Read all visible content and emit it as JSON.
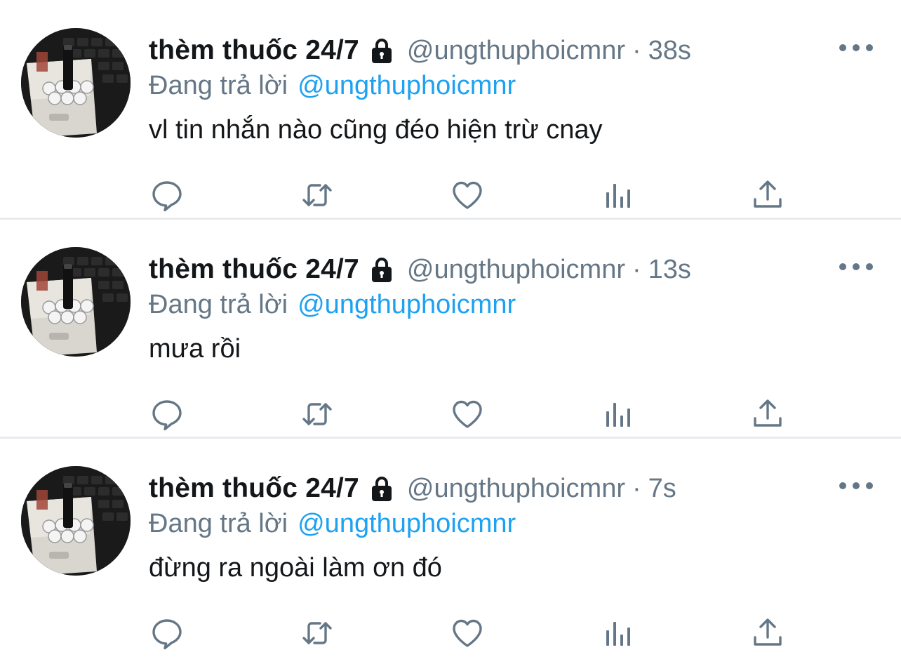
{
  "tweets": [
    {
      "name": "thèm thuốc 24/7",
      "handle": "@ungthuphoicmnr",
      "separator": "·",
      "time": "38s",
      "reply_prefix": "Đang trả lời",
      "reply_to": "@ungthuphoicmnr",
      "text": "vl tin nhắn nào cũng đéo hiện trừ cnay"
    },
    {
      "name": "thèm thuốc 24/7",
      "handle": "@ungthuphoicmnr",
      "separator": "·",
      "time": "13s",
      "reply_prefix": "Đang trả lời",
      "reply_to": "@ungthuphoicmnr",
      "text": "mưa rồi"
    },
    {
      "name": "thèm thuốc 24/7",
      "handle": "@ungthuphoicmnr",
      "separator": "·",
      "time": "7s",
      "reply_prefix": "Đang trả lời",
      "reply_to": "@ungthuphoicmnr",
      "text": "đừng ra ngoài làm ơn đó"
    }
  ],
  "icons": {
    "lock": "lock-icon",
    "more": "more-icon",
    "reply": "reply-icon",
    "retweet": "retweet-icon",
    "like": "heart-icon",
    "stats": "stats-icon",
    "share": "share-icon"
  },
  "colors": {
    "text": "#14171a",
    "muted": "#657786",
    "accent": "#1da1f2",
    "divider": "#e8ebee"
  }
}
